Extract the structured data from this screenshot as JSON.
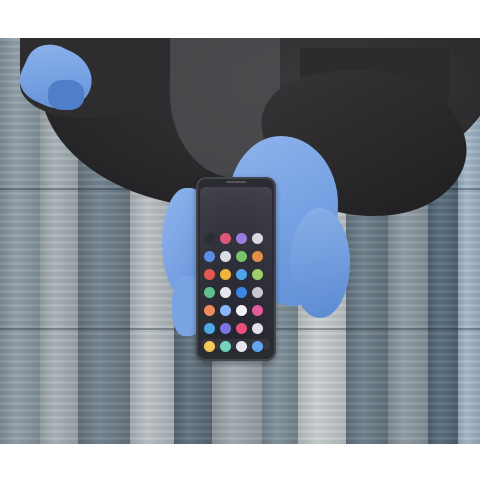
{
  "scene": {
    "background": "#ffffff",
    "floor_plank_colors": [
      "#8c9ba6",
      "#a7b1b7",
      "#6f7f8b",
      "#b9c0c4",
      "#5e6f7c",
      "#9fa9af",
      "#7e8e99",
      "#c8ced1",
      "#6b7c88",
      "#8d9aa3",
      "#54697a",
      "#a3b7c9"
    ],
    "jacket_color": "#2a2a2c",
    "glove_color": "#7ea6e6"
  },
  "phone": {
    "body_color": "#2b2c32",
    "app_icon_colors": [
      [
        "#2b2c32",
        "#e0567a",
        "#9a7de0",
        "#d9d9e0"
      ],
      [
        "#5a8de8",
        "#d8dde4",
        "#79c56a",
        "#e58e4a"
      ],
      [
        "#e2574c",
        "#f0b43a",
        "#4fa3e8",
        "#9ccf6a"
      ],
      [
        "#5fc08d",
        "#e6e6ec",
        "#3f84e6",
        "#c7c7cf"
      ],
      [
        "#f08a5d",
        "#8ab4f8",
        "#f3f3f6",
        "#e25b9a"
      ],
      [
        "#4aa8e8",
        "#7b74e0",
        "#ea4f7b",
        "#dfdfe6"
      ],
      [
        "#f2c64a",
        "#6ad1b8",
        "#e5e5eb",
        "#5aa0ef"
      ]
    ]
  }
}
